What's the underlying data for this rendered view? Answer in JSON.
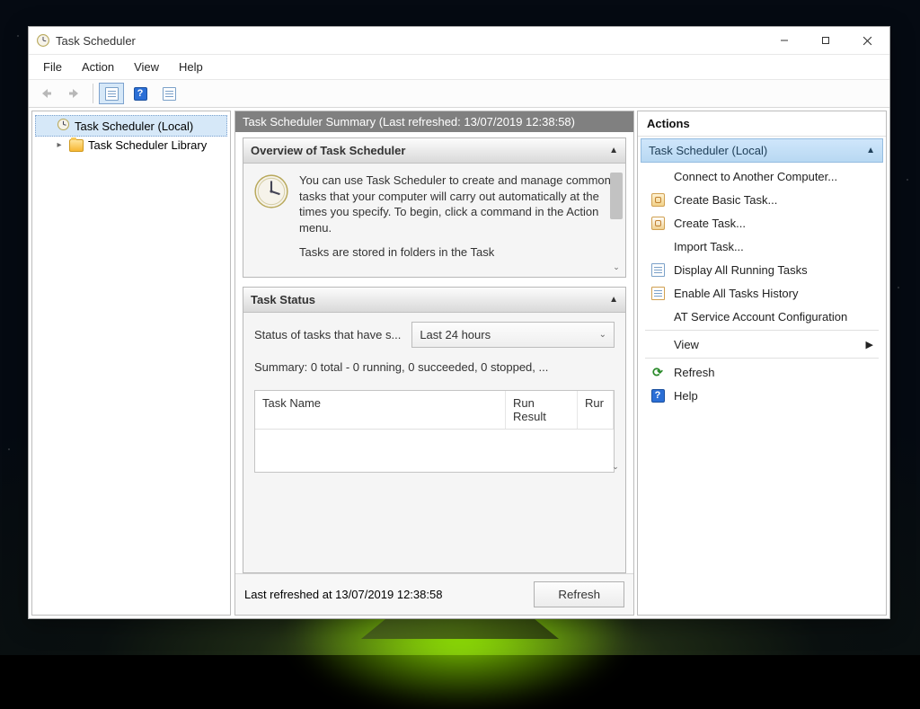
{
  "title_text": "Task Scheduler",
  "menu": {
    "file": "File",
    "action": "Action",
    "view": "View",
    "help": "Help"
  },
  "tree": {
    "root": "Task Scheduler (Local)",
    "child": "Task Scheduler Library"
  },
  "summary_header": "Task Scheduler Summary (Last refreshed: 13/07/2019 12:38:58)",
  "overview": {
    "title": "Overview of Task Scheduler",
    "text1": "You can use Task Scheduler to create and manage common tasks that your computer will carry out automatically at the times you specify. To begin, click a command in the Action menu.",
    "text2": "Tasks are stored in folders in the Task"
  },
  "status": {
    "title": "Task Status",
    "label": "Status of tasks that have s...",
    "dropdown": "Last 24 hours",
    "summary_line": "Summary: 0 total - 0 running, 0 succeeded, 0 stopped, ...",
    "col1": "Task Name",
    "col2": "Run Result",
    "col3": "Rur"
  },
  "footer": {
    "last_refreshed": "Last refreshed at 13/07/2019 12:38:58",
    "refresh": "Refresh"
  },
  "actions": {
    "title": "Actions",
    "sub": "Task Scheduler (Local)",
    "items": [
      "Connect to Another Computer...",
      "Create Basic Task...",
      "Create Task...",
      "Import Task...",
      "Display All Running Tasks",
      "Enable All Tasks History",
      "AT Service Account Configuration",
      "View",
      "Refresh",
      "Help"
    ]
  }
}
